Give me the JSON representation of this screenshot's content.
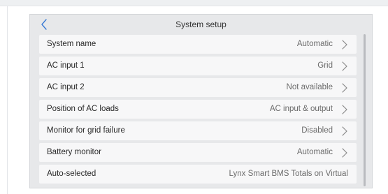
{
  "header": {
    "title": "System setup"
  },
  "rows": [
    {
      "label": "System name",
      "value": "Automatic"
    },
    {
      "label": "AC input 1",
      "value": "Grid"
    },
    {
      "label": "AC input 2",
      "value": "Not available"
    },
    {
      "label": "Position of AC loads",
      "value": "AC input & output"
    },
    {
      "label": "Monitor for grid failure",
      "value": "Disabled"
    },
    {
      "label": "Battery monitor",
      "value": "Automatic"
    },
    {
      "label": "Auto-selected",
      "value": "Lynx Smart BMS Totals on Virtual"
    }
  ],
  "icons": {
    "back": "chevron-left-icon",
    "row_arrow": "chevron-right-icon"
  },
  "colors": {
    "accent": "#3a7bd5",
    "screen_bg": "#e7e8ea",
    "row_bg": "#f7f7f8"
  }
}
